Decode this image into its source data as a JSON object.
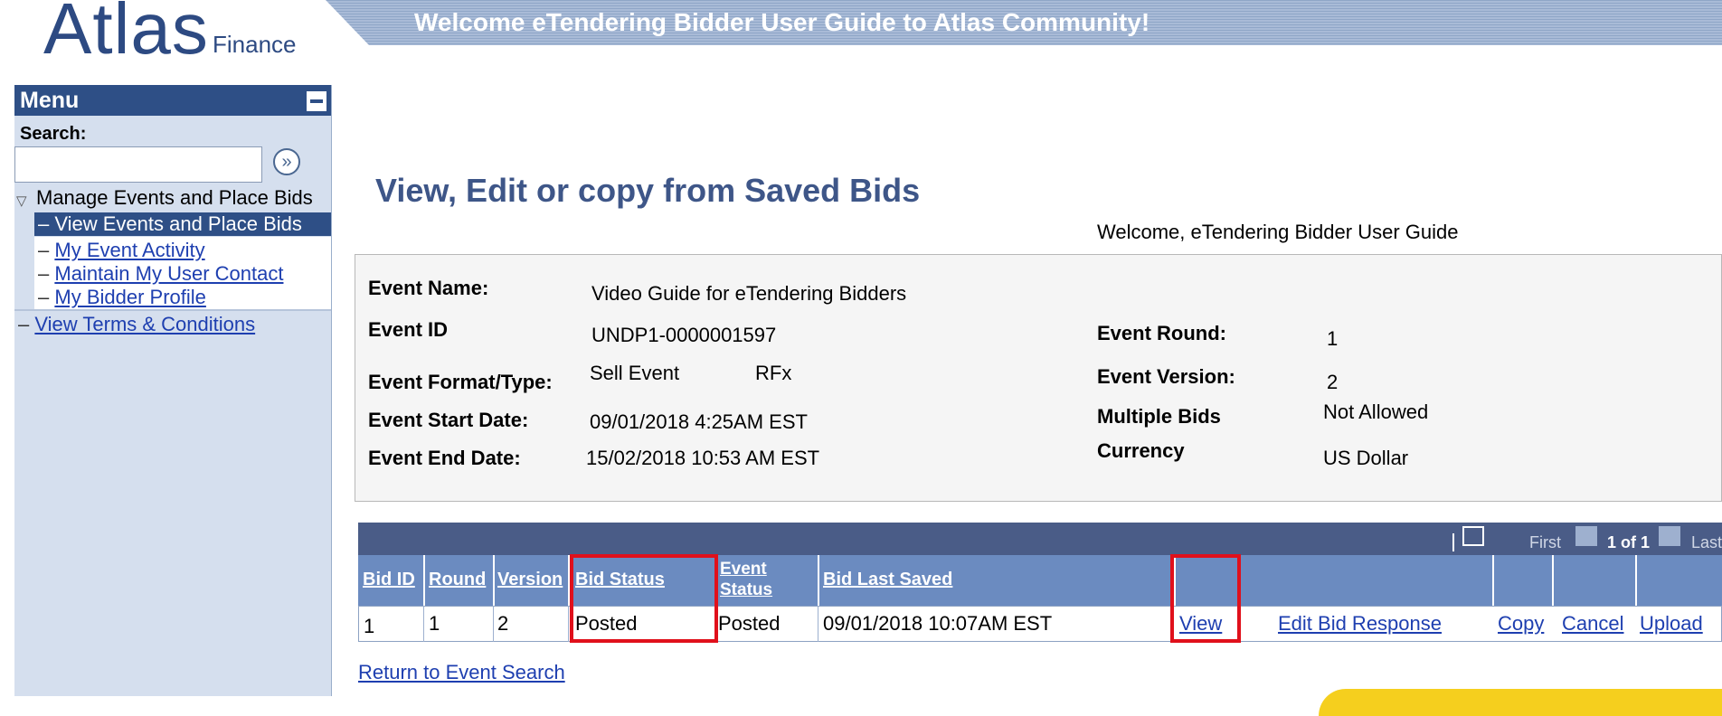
{
  "logo": {
    "word": "Atlas",
    "sub": "Finance"
  },
  "banner": {
    "title": "Welcome eTendering Bidder User Guide to Atlas Community!"
  },
  "menu": {
    "title": "Menu",
    "search_label": "Search:",
    "search_value": "",
    "group": "Manage Events and Place Bids",
    "active_item": "– View Events and Place Bids",
    "items": [
      "My Event Activity",
      "Maintain My User Contact",
      "My Bidder Profile"
    ],
    "terms": "View Terms & Conditions",
    "dash": "–"
  },
  "page": {
    "title": "View, Edit or copy from Saved Bids",
    "welcome": "Welcome, eTendering Bidder User Guide"
  },
  "event": {
    "name_label": "Event Name:",
    "name": "Video Guide for eTendering Bidders",
    "id_label": "Event ID",
    "id": "UNDP1-0000001597",
    "format_label": "Event Format/Type:",
    "format": "Sell Event",
    "type": "RFx",
    "start_label": "Event Start Date:",
    "start": "09/01/2018  4:25AM EST",
    "end_label": "Event End Date:",
    "end": "15/02/2018 10:53 AM EST",
    "round_label": "Event Round:",
    "round": "1",
    "version_label": "Event Version:",
    "version": "2",
    "multiple_label": "Multiple Bids",
    "multiple": "Not Allowed",
    "currency_label": "Currency",
    "currency": "US Dollar"
  },
  "grid": {
    "nav": {
      "first": "First",
      "count": "1 of 1",
      "last": "Last"
    },
    "headers": {
      "bid_id": "Bid ID",
      "round": "Round",
      "version": "Version",
      "bid_status": "Bid Status",
      "event_status_1": "Event",
      "event_status_2": "Status",
      "bid_last_saved": "Bid Last Saved"
    },
    "row": {
      "bid_id": "1",
      "round": "1",
      "version": "2",
      "bid_status": "Posted",
      "event_status": "Posted",
      "bid_last_saved": "09/01/2018 10:07AM EST",
      "view": "View",
      "edit": "Edit Bid Response",
      "copy": "Copy",
      "cancel": "Cancel",
      "upload": "Upload"
    }
  },
  "return_link": "Return to Event Search",
  "colors": {
    "nav_blue": "#2e4f86",
    "header_blue": "#6b8bc0",
    "highlight_red": "#e0101b",
    "link": "#1e3fb0"
  }
}
